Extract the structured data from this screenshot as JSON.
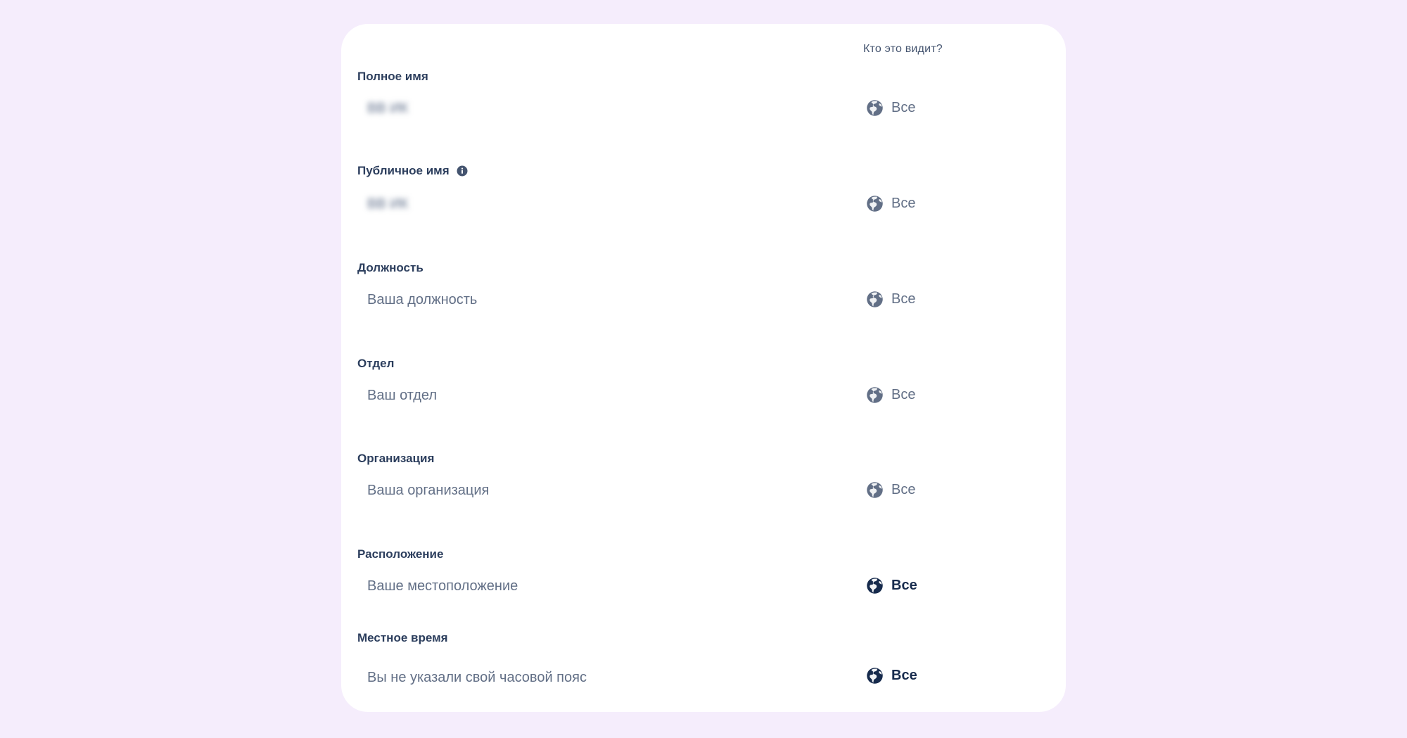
{
  "header": {
    "who_sees": "Кто это видит?"
  },
  "fields": [
    {
      "label": "Полное имя",
      "value": "ВВ ИК",
      "value_blurred": true,
      "visibility": "Все"
    },
    {
      "label": "Публичное имя",
      "has_info_icon": true,
      "value": "ВВ ИК",
      "value_blurred": true,
      "visibility": "Все"
    },
    {
      "label": "Должность",
      "value": "Ваша должность",
      "visibility": "Все"
    },
    {
      "label": "Отдел",
      "value": "Ваш отдел",
      "visibility": "Все"
    },
    {
      "label": "Организация",
      "value": "Ваша организация",
      "visibility": "Все"
    },
    {
      "label": "Расположение",
      "value": "Ваше местоположение",
      "visibility": "Все",
      "visibility_active": true
    },
    {
      "label": "Местное время",
      "value": "Вы не указали свой часовой пояс",
      "visibility": "Все",
      "visibility_active": true
    }
  ],
  "colors": {
    "background": "#f5edfc",
    "card": "#ffffff",
    "label": "#2c3e5d",
    "muted_text": "#626f86",
    "active_text": "#172b4d"
  },
  "icons": {
    "visibility": "globe-icon",
    "info": "info-icon"
  }
}
